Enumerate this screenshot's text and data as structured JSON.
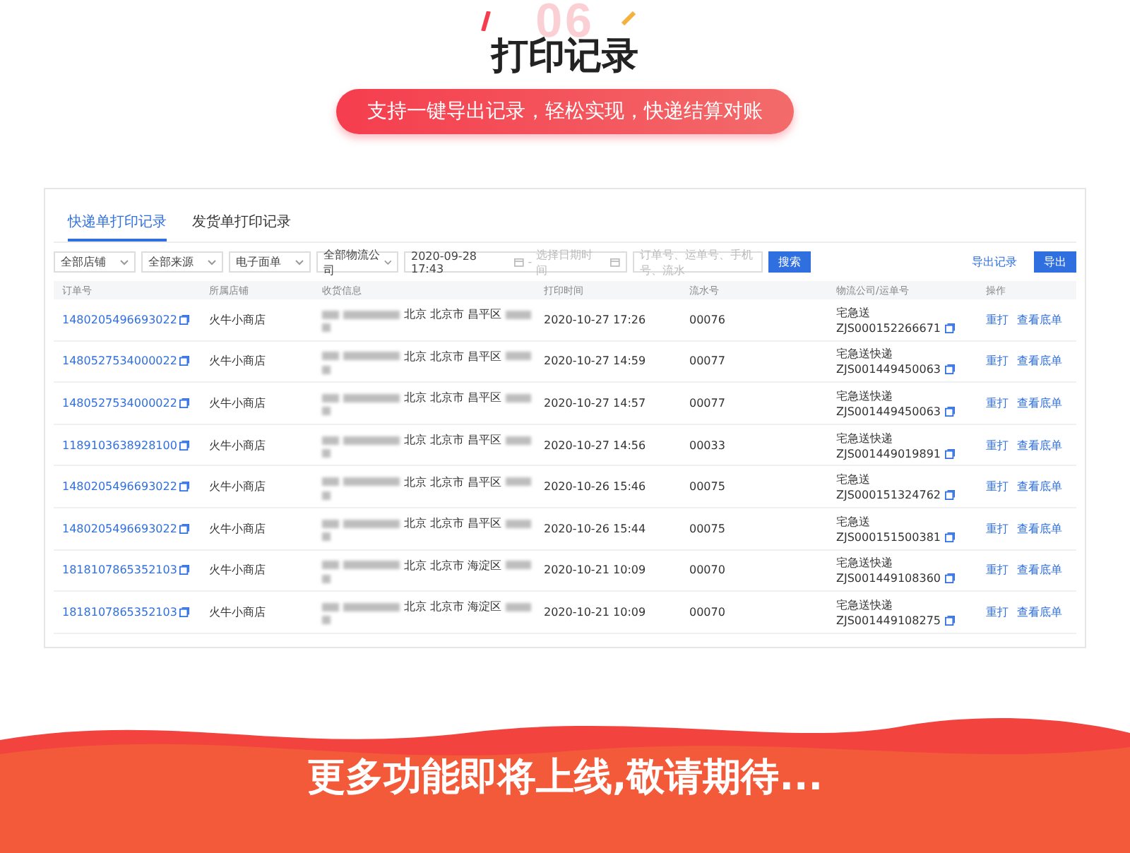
{
  "hero": {
    "number": "06",
    "title": "打印记录",
    "tagline": "支持一键导出记录，轻松实现，快递结算对账"
  },
  "tabs": [
    {
      "label": "快递单打印记录",
      "selected": true
    },
    {
      "label": "发货单打印记录",
      "selected": false
    }
  ],
  "filters": {
    "dropdowns": [
      "全部店铺",
      "全部来源",
      "电子面单",
      "全部物流公司"
    ],
    "date_start": "2020-09-28 17:43",
    "date_separator": "-",
    "date_end_placeholder": "选择日期时间",
    "search_placeholder": "订单号、运单号、手机号、流水",
    "search_button": "搜索",
    "export_link": "导出记录",
    "export_button": "导出"
  },
  "table": {
    "columns": [
      "订单号",
      "所属店铺",
      "收货信息",
      "打印时间",
      "流水号",
      "物流公司/运单号",
      "操作"
    ],
    "rows": [
      {
        "order": "1480205496693022",
        "shop": "火牛小商店",
        "address": "北京 北京市 昌平区",
        "time": "2020-10-27 17:26",
        "serial": "00076",
        "carrier": "宅急送",
        "waybill": "ZJS000152266671",
        "actions": [
          "重打",
          "查看底单"
        ]
      },
      {
        "order": "1480527534000022",
        "shop": "火牛小商店",
        "address": "北京 北京市 昌平区",
        "time": "2020-10-27 14:59",
        "serial": "00077",
        "carrier": "宅急送快递",
        "waybill": "ZJS001449450063",
        "actions": [
          "重打",
          "查看底单"
        ]
      },
      {
        "order": "1480527534000022",
        "shop": "火牛小商店",
        "address": "北京 北京市 昌平区",
        "time": "2020-10-27 14:57",
        "serial": "00077",
        "carrier": "宅急送快递",
        "waybill": "ZJS001449450063",
        "actions": [
          "重打",
          "查看底单"
        ]
      },
      {
        "order": "1189103638928100",
        "shop": "火牛小商店",
        "address": "北京 北京市 昌平区",
        "time": "2020-10-27 14:56",
        "serial": "00033",
        "carrier": "宅急送快递",
        "waybill": "ZJS001449019891",
        "actions": [
          "重打",
          "查看底单"
        ]
      },
      {
        "order": "1480205496693022",
        "shop": "火牛小商店",
        "address": "北京 北京市 昌平区",
        "time": "2020-10-26 15:46",
        "serial": "00075",
        "carrier": "宅急送",
        "waybill": "ZJS000151324762",
        "actions": [
          "重打",
          "查看底单"
        ]
      },
      {
        "order": "1480205496693022",
        "shop": "火牛小商店",
        "address": "北京 北京市 昌平区",
        "time": "2020-10-26 15:44",
        "serial": "00075",
        "carrier": "宅急送",
        "waybill": "ZJS000151500381",
        "actions": [
          "重打",
          "查看底单"
        ]
      },
      {
        "order": "1818107865352103",
        "shop": "火牛小商店",
        "address": "北京 北京市 海淀区",
        "time": "2020-10-21 10:09",
        "serial": "00070",
        "carrier": "宅急送快递",
        "waybill": "ZJS001449108360",
        "actions": [
          "重打",
          "查看底单"
        ]
      },
      {
        "order": "1818107865352103",
        "shop": "火牛小商店",
        "address": "北京 北京市 海淀区",
        "time": "2020-10-21 10:09",
        "serial": "00070",
        "carrier": "宅急送快递",
        "waybill": "ZJS001449108275",
        "actions": [
          "重打",
          "查看底单"
        ]
      }
    ]
  },
  "footer": {
    "text": "更多功能即将上线,敬请期待..."
  }
}
